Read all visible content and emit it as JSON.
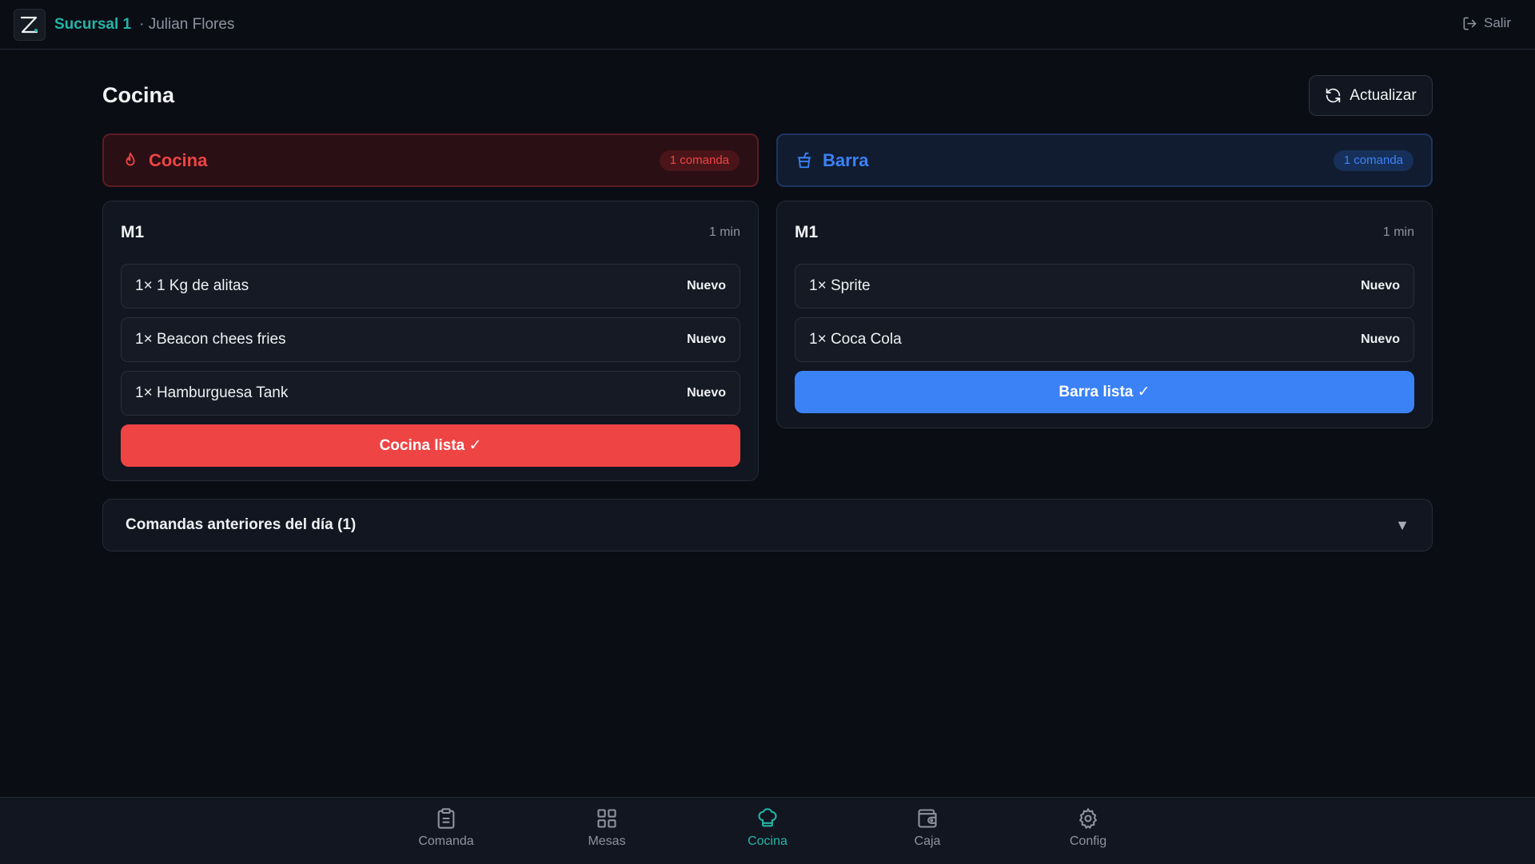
{
  "header": {
    "branch": "Sucursal 1",
    "user": "· Julian Flores",
    "logout_label": "Salir"
  },
  "page": {
    "title": "Cocina",
    "refresh_label": "Actualizar"
  },
  "stations": {
    "cocina": {
      "name": "Cocina",
      "badge": "1 comanda",
      "order": {
        "table": "M1",
        "elapsed": "1 min",
        "items": [
          {
            "label": "1× 1 Kg de alitas",
            "status": "Nuevo"
          },
          {
            "label": "1× Beacon chees fries",
            "status": "Nuevo"
          },
          {
            "label": "1× Hamburguesa Tank",
            "status": "Nuevo"
          }
        ],
        "ready_label": "Cocina lista ✓"
      }
    },
    "barra": {
      "name": "Barra",
      "badge": "1 comanda",
      "order": {
        "table": "M1",
        "elapsed": "1 min",
        "items": [
          {
            "label": "1× Sprite",
            "status": "Nuevo"
          },
          {
            "label": "1× Coca Cola",
            "status": "Nuevo"
          }
        ],
        "ready_label": "Barra lista ✓"
      }
    }
  },
  "previous": {
    "label": "Comandas anteriores del día (1)"
  },
  "nav": {
    "items": [
      {
        "label": "Comanda",
        "icon": "clipboard-icon"
      },
      {
        "label": "Mesas",
        "icon": "grid-icon"
      },
      {
        "label": "Cocina",
        "icon": "chef-hat-icon"
      },
      {
        "label": "Caja",
        "icon": "wallet-icon"
      },
      {
        "label": "Config",
        "icon": "gear-icon"
      }
    ],
    "active": "Cocina"
  },
  "colors": {
    "accent": "#22b5a8",
    "cocina": "#ef4444",
    "barra": "#3b82f6",
    "background": "#0a0d14"
  }
}
